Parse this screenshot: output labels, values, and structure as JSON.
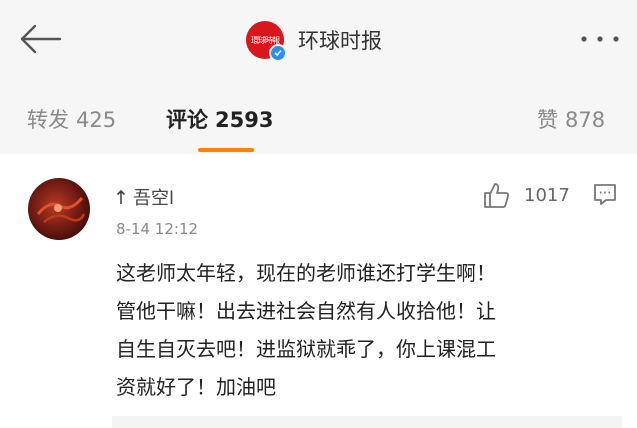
{
  "header": {
    "account_name": "环球时报",
    "logo_text": "環球時報",
    "icons": {
      "back": "back-arrow-icon",
      "more": "more-dots-icon",
      "verified": "verified-badge-icon"
    },
    "accent": "#d8161b"
  },
  "tabs": [
    {
      "label": "转发",
      "count": "425",
      "active": false
    },
    {
      "label": "评论",
      "count": "2593",
      "active": true
    },
    {
      "label": "赞",
      "count": "878",
      "active": false
    }
  ],
  "tab_indicator_color": "#ff8200",
  "comment": {
    "username": "吾空l",
    "timestamp": "8-14 12:12",
    "likes": "1017",
    "lines": [
      "这老师太年轻，现在的老师谁还打学生啊！",
      "管他干嘛！出去进社会自然有人收拾他！让",
      "自生自灭去吧！进监狱就乖了，你上课混工",
      "资就好了！加油吧"
    ],
    "icons": {
      "like": "thumbs-up-icon",
      "reply": "comment-bubble-icon",
      "username_prefix": "up-arrow-icon"
    }
  }
}
